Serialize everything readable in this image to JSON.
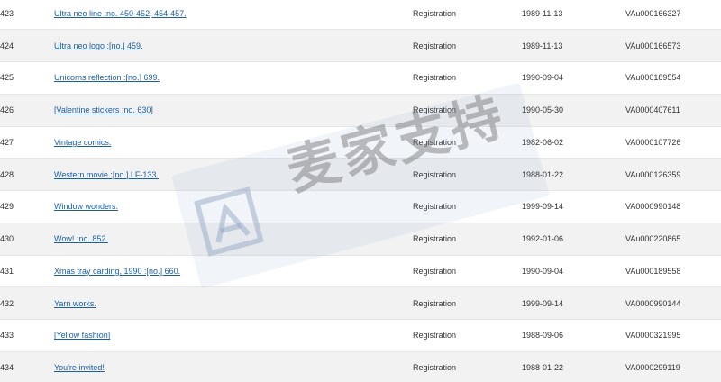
{
  "rows": [
    {
      "num": "423",
      "title": "Ultra neo line :no. 450-452, 454-457.",
      "type": "Registration",
      "date": "1989-11-13",
      "reg": "VAu000166327"
    },
    {
      "num": "424",
      "title": "Ultra neo logo :[no.] 459.",
      "type": "Registration",
      "date": "1989-11-13",
      "reg": "VAu000166573"
    },
    {
      "num": "425",
      "title": "Unicorns reflection :[no.] 699.",
      "type": "Registration",
      "date": "1990-09-04",
      "reg": "VAu000189554"
    },
    {
      "num": "426",
      "title": "[Valentine stickers :no. 630]",
      "type": "Registration",
      "date": "1990-05-30",
      "reg": "VA0000407611"
    },
    {
      "num": "427",
      "title": "Vintage comics.",
      "type": "Registration",
      "date": "1982-06-02",
      "reg": "VA0000107726"
    },
    {
      "num": "428",
      "title": "Western movie :[no.] LF-133.",
      "type": "Registration",
      "date": "1988-01-22",
      "reg": "VAu000126359"
    },
    {
      "num": "429",
      "title": "Window wonders.",
      "type": "Registration",
      "date": "1999-09-14",
      "reg": "VA0000990148"
    },
    {
      "num": "430",
      "title": "Wow! :no. 852.",
      "type": "Registration",
      "date": "1992-01-06",
      "reg": "VAu000220865"
    },
    {
      "num": "431",
      "title": "Xmas tray carding, 1990 :[no.] 660.",
      "type": "Registration",
      "date": "1990-09-04",
      "reg": "VAu000189558"
    },
    {
      "num": "432",
      "title": "Yarn works.",
      "type": "Registration",
      "date": "1999-09-14",
      "reg": "VA0000990144"
    },
    {
      "num": "433",
      "title": "[Yellow fashion]",
      "type": "Registration",
      "date": "1988-09-06",
      "reg": "VA0000321995"
    },
    {
      "num": "434",
      "title": "You're invited!",
      "type": "Registration",
      "date": "1988-01-22",
      "reg": "VA0000299119"
    }
  ],
  "watermark": {
    "text": "麦家支持",
    "logo_icon": "watermark-logo-icon"
  },
  "colors": {
    "link": "#1a5fa6",
    "stripe": "#f2f2f2",
    "text": "#333333"
  }
}
